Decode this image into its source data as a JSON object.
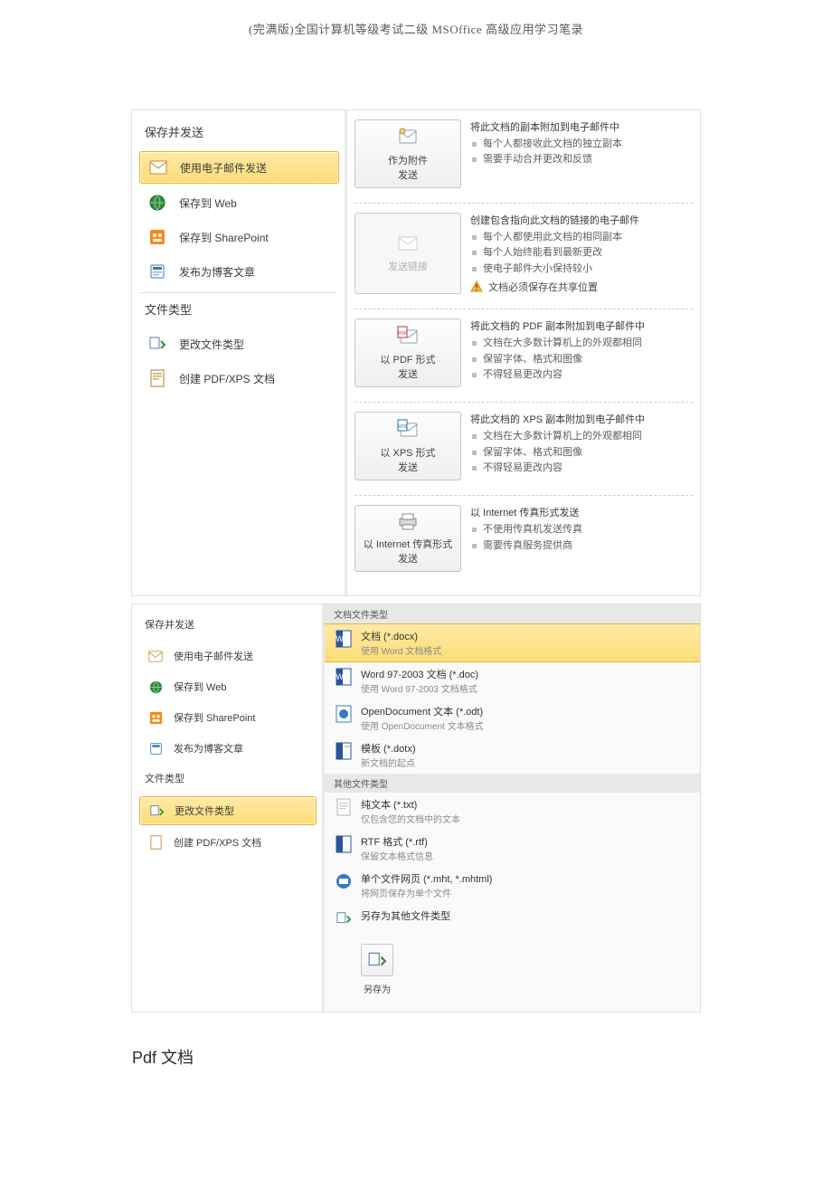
{
  "doc_header": "(完满版)全国计算机等级考试二级 MSOffice 高级应用学习笔录",
  "footer_line": "Pdf 文档",
  "ss1": {
    "section1_title": "保存并发送",
    "left_items": [
      {
        "label": "使用电子邮件发送",
        "icon": "mail",
        "selected": true
      },
      {
        "label": "保存到 Web",
        "icon": "globe"
      },
      {
        "label": "保存到 SharePoint",
        "icon": "sharepoint"
      },
      {
        "label": "发布为博客文章",
        "icon": "blog"
      }
    ],
    "section2_title": "文件类型",
    "left_items2": [
      {
        "label": "更改文件类型",
        "icon": "change"
      },
      {
        "label": "创建 PDF/XPS 文档",
        "icon": "pdf"
      }
    ],
    "cards": [
      {
        "btn_label": "作为附件\n发送",
        "title": "将此文档的副本附加到电子邮件中",
        "bullets": [
          "每个人都接收此文档的独立副本",
          "需要手动合并更改和反馈"
        ],
        "disabled": false
      },
      {
        "btn_label": "发送链接",
        "title": "创建包含指向此文档的链接的电子邮件",
        "bullets": [
          "每个人都使用此文档的相同副本",
          "每个人始终能看到最新更改",
          "使电子邮件大小保持较小"
        ],
        "warning": "文档必须保存在共享位置",
        "disabled": true
      },
      {
        "btn_label": "以 PDF 形式\n发送",
        "title": "将此文档的 PDF 副本附加到电子邮件中",
        "bullets": [
          "文档在大多数计算机上的外观都相同",
          "保留字体、格式和图像",
          "不得轻易更改内容"
        ]
      },
      {
        "btn_label": "以 XPS 形式\n发送",
        "title": "将此文档的 XPS 副本附加到电子邮件中",
        "bullets": [
          "文档在大多数计算机上的外观都相同",
          "保留字体、格式和图像",
          "不得轻易更改内容"
        ]
      },
      {
        "btn_label": "以 Internet 传真形式\n发送",
        "title": "以 Internet 传真形式发送",
        "bullets": [
          "不使用传真机发送传真",
          "需要传真服务提供商"
        ]
      }
    ]
  },
  "ss2": {
    "section1_title": "保存并发送",
    "left_items": [
      {
        "label": "使用电子邮件发送",
        "icon": "mail"
      },
      {
        "label": "保存到 Web",
        "icon": "globe"
      },
      {
        "label": "保存到 SharePoint",
        "icon": "sharepoint"
      },
      {
        "label": "发布为博客文章",
        "icon": "blog"
      }
    ],
    "section2_title": "文件类型",
    "left_items2": [
      {
        "label": "更改文件类型",
        "icon": "change",
        "selected": true
      },
      {
        "label": "创建 PDF/XPS 文档",
        "icon": "pdf"
      }
    ],
    "right_top_header": "文档文件类型",
    "doc_types": [
      {
        "name": "文档 (*.docx)",
        "desc": "使用 Word 文档格式",
        "selected": true
      },
      {
        "name": "Word 97-2003 文档 (*.doc)",
        "desc": "使用 Word 97-2003 文档格式"
      },
      {
        "name": "OpenDocument 文本 (*.odt)",
        "desc": "使用 OpenDocument 文本格式"
      },
      {
        "name": "模板 (*.dotx)",
        "desc": "新文档的起点"
      }
    ],
    "other_header": "其他文件类型",
    "other_types": [
      {
        "name": "纯文本 (*.txt)",
        "desc": "仅包含您的文档中的文本"
      },
      {
        "name": "RTF 格式 (*.rtf)",
        "desc": "保留文本格式信息"
      },
      {
        "name": "单个文件网页 (*.mht, *.mhtml)",
        "desc": "将网页保存为单个文件"
      },
      {
        "name": "另存为其他文件类型",
        "desc": ""
      }
    ],
    "saveas_label": "另存为"
  }
}
